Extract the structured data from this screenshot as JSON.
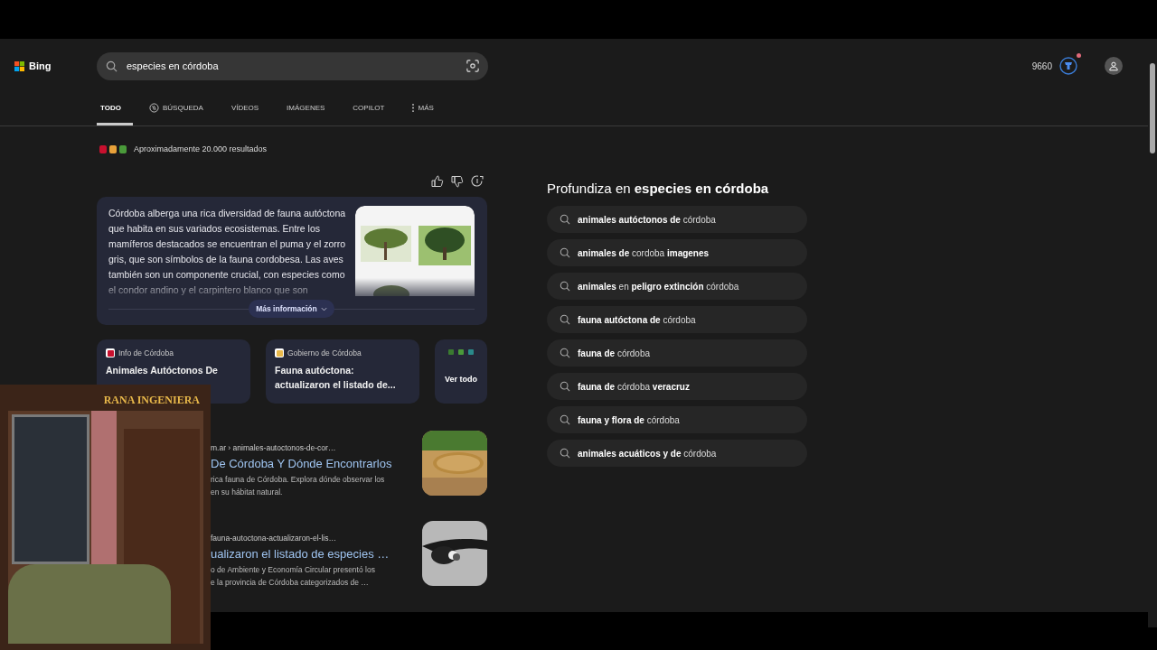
{
  "header": {
    "logo": "Bing",
    "search": {
      "value": "especies en córdoba"
    },
    "points": "9660",
    "rewards_alert": true
  },
  "tabs": [
    {
      "label": "TODO",
      "selected": true
    },
    {
      "label": "BÚSQUEDA",
      "selected": false
    },
    {
      "label": "VÍDEOS",
      "selected": false
    },
    {
      "label": "IMÁGENES",
      "selected": false
    },
    {
      "label": "COPILOT",
      "selected": false
    },
    {
      "label": "MÁS",
      "selected": false
    }
  ],
  "results_count": "Aproximadamente 20.000 resultados",
  "answer": {
    "text": "Córdoba alberga una rica diversidad de fauna autóctona que habita en sus variados ecosistemas. Entre los mamíferos destacados se encuentran el puma y el zorro gris, que son símbolos de la fauna cordobesa. Las aves también son un componente crucial, con especies como el condor andino y el carpintero blanco que son",
    "more_button": "Más información"
  },
  "sources": [
    {
      "site": "Info de Córdoba",
      "title": "Animales Autóctonos De",
      "color": "#c8102e"
    },
    {
      "site": "Gobierno de Córdoba",
      "title": "Fauna autóctona: actualizaron el listado de...",
      "color": "#e8b84a"
    }
  ],
  "see_all": "Ver todo",
  "results": [
    {
      "url": "m.ar › animales-autoctonos-de-cor…",
      "title": "De Córdoba Y Dónde Encontrarlos",
      "snippet": [
        "rica fauna de Córdoba. Explora dónde observar los",
        "en su hábitat natural."
      ]
    },
    {
      "url": "fauna-autoctona-actualizaron-el-lis…",
      "title": "ualizaron el listado de especies …",
      "snippet": [
        "o de Ambiente y Economía Circular presentó los",
        "e la provincia de Córdoba categorizados de …"
      ]
    }
  ],
  "related": {
    "title": "Profundiza en **especies en córdoba**",
    "items": [
      "**animales autóctonos de** córdoba",
      "**animales de** cordoba **imagenes**",
      "**animales** en **peligro extinción** córdoba",
      "**fauna autóctona de** córdoba",
      "**fauna de** córdoba",
      "**fauna de** córdoba **veracruz**",
      "**fauna y flora de** córdoba",
      "**animales acuáticos y de** córdoba"
    ]
  },
  "overlay": {
    "title": "RANA INGENIERA"
  }
}
